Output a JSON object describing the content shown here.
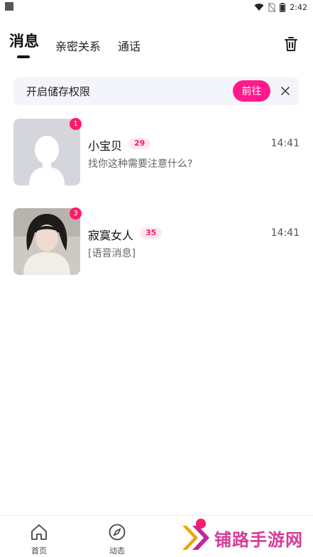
{
  "status_bar": {
    "time": "2:42"
  },
  "tabs": [
    {
      "label": "消息",
      "active": true
    },
    {
      "label": "亲密关系",
      "active": false
    },
    {
      "label": "通话",
      "active": false
    }
  ],
  "permission_banner": {
    "text": "开启储存权限",
    "button_label": "前往"
  },
  "conversations": [
    {
      "name": "小宝贝",
      "age": "29",
      "time": "14:41",
      "preview": "找你这种需要注意什么?",
      "unread": "1",
      "avatar": "default-avatar"
    },
    {
      "name": "寂寞女人",
      "age": "35",
      "time": "14:41",
      "preview": "[语音消息]",
      "unread": "3",
      "avatar": "photo-avatar"
    }
  ],
  "bottom_nav": [
    {
      "label": "首页",
      "icon": "home-icon"
    },
    {
      "label": "动态",
      "icon": "compass-icon"
    }
  ],
  "watermark": {
    "text": "铺路手游网"
  },
  "colors": {
    "accent": "#ff1a8c",
    "badge": "#ff1a6a",
    "banner_bg": "#f4f5fa",
    "watermark": "#d63a96"
  }
}
